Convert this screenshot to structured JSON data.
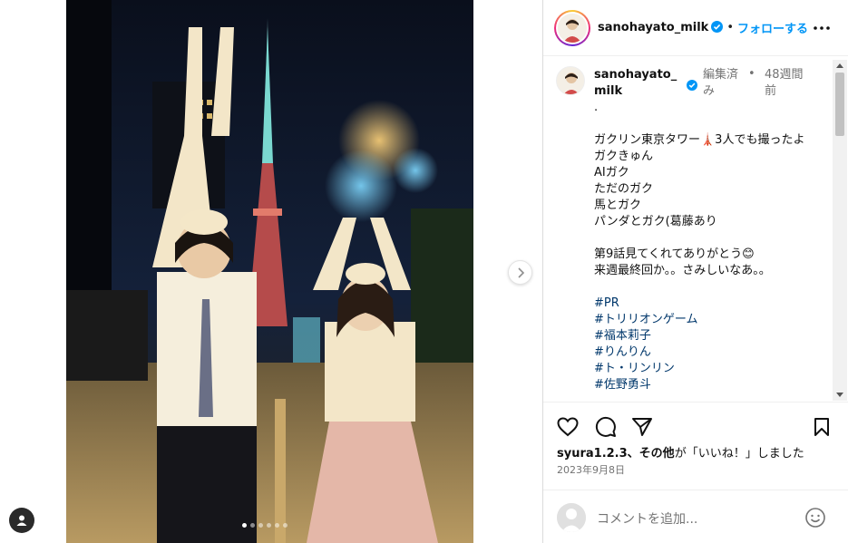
{
  "post": {
    "username": "sanohayato_milk",
    "follow_label": "フォローする",
    "separator": "•",
    "more_label": "...",
    "carousel": {
      "slide_count": 6,
      "active_index": 0
    }
  },
  "caption": {
    "username": "sanohayato_milk",
    "edited": "編集済み",
    "bullet": "•",
    "time": "48週間前",
    "lines": [
      ".",
      "",
      "ガクリン東京タワー🗼3人でも撮ったよ",
      "ガクきゅん",
      "AIガク",
      "ただのガク",
      "馬とガク",
      "パンダとガク(葛藤あり",
      "",
      "第9話見てくれてありがとう😊",
      "来週最終回か。。さみしいなあ。。",
      ""
    ],
    "hashtags": [
      "#PR",
      "#トリリオンゲーム",
      "#福本莉子",
      "#りんりん",
      "#ト・リンリン",
      "#佐野勇斗"
    ]
  },
  "engagement": {
    "likers": "syura1.2.3、",
    "others": "その他",
    "suffix": "が「いいね！」しました",
    "date": "2023年9月8日"
  },
  "comment": {
    "placeholder": "コメントを追加..."
  },
  "colors": {
    "accent": "#0095f6",
    "hashtag": "#00376b",
    "muted": "#737373"
  }
}
